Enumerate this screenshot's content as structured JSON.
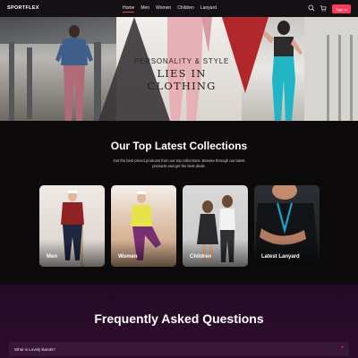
{
  "brand": {
    "logo": "SPORTFLEX"
  },
  "nav": {
    "items": [
      {
        "label": "Home",
        "active": true
      },
      {
        "label": "Men",
        "active": false
      },
      {
        "label": "Women",
        "active": false
      },
      {
        "label": "Children",
        "active": false
      },
      {
        "label": "Lanyard",
        "active": false
      }
    ],
    "signin_label": "Sign In",
    "icons": [
      "search-icon",
      "cart-icon"
    ]
  },
  "hero": {
    "line1": "PERSONALITY & STYLE",
    "line2": "LIES IN CLOTHING"
  },
  "collections": {
    "title": "Our Top Latest Collections",
    "description": "Get the best priced products from our top collections. Browse through our latest products and get the best deals.",
    "cards": [
      {
        "label": "Men"
      },
      {
        "label": "Women"
      },
      {
        "label": "Children"
      },
      {
        "label": "Latest Lanyard"
      }
    ]
  },
  "faq": {
    "title": "Frequently Asked Questions",
    "items": [
      {
        "question": "What is Lovely Bands?"
      }
    ]
  },
  "colors": {
    "accent": "#ff3b5c",
    "background": "#0d0a0c",
    "faq_bg": "#2a0b2b"
  }
}
